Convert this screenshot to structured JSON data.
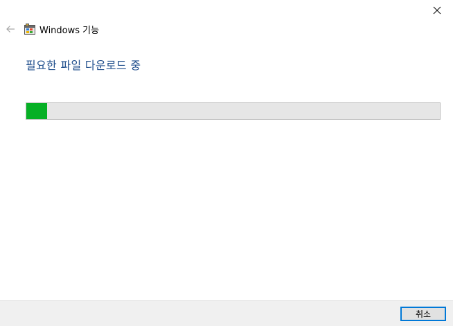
{
  "window": {
    "title": "Windows 기능",
    "icons": {
      "close": "close-icon",
      "back": "back-arrow-icon",
      "app": "windows-features-icon"
    }
  },
  "main": {
    "heading": "필요한 파일 다운로드 중",
    "progress": {
      "value": 0.05,
      "fill_color": "#06b025",
      "track_color": "#e6e6e6"
    }
  },
  "footer": {
    "cancel_label": "취소"
  },
  "colors": {
    "heading": "#1f4e8c",
    "accent": "#0078d7",
    "footer_bg": "#f0f0f0"
  }
}
